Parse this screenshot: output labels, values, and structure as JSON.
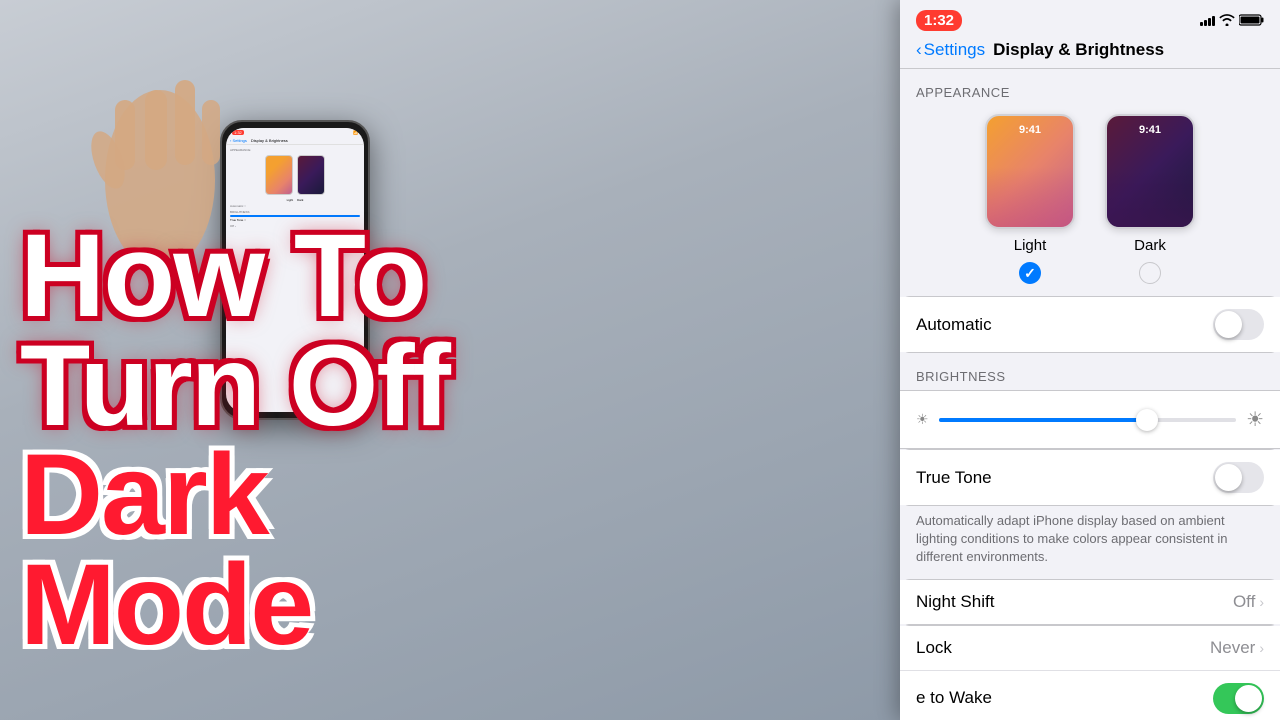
{
  "overlay": {
    "line1": "How To",
    "line2": "Turn Off",
    "line3": "Dark",
    "line4": "Mode"
  },
  "status_bar": {
    "time": "1:32",
    "wifi_icon": "wifi",
    "battery_icon": "battery"
  },
  "nav": {
    "back_label": "Settings",
    "title": "Display & Brightness"
  },
  "appearance": {
    "section_label": "APPEARANCE",
    "light_label": "Light",
    "dark_label": "Dark",
    "light_selected": true,
    "dark_selected": false,
    "preview_time": "9:41"
  },
  "automatic": {
    "label": "Automatic",
    "enabled": false
  },
  "brightness": {
    "section_label": "BRIGHTNESS",
    "fill_percent": 70
  },
  "true_tone": {
    "label": "True Tone",
    "enabled": false,
    "description": "Automatically adapt iPhone display based on ambient lighting conditions to make colors appear consistent in different environments."
  },
  "night_shift": {
    "label": "Night Shift",
    "value": "Off"
  },
  "auto_lock": {
    "label": "Lock",
    "value": "Never"
  },
  "raise_to_wake": {
    "label": "e to Wake",
    "enabled": true
  }
}
